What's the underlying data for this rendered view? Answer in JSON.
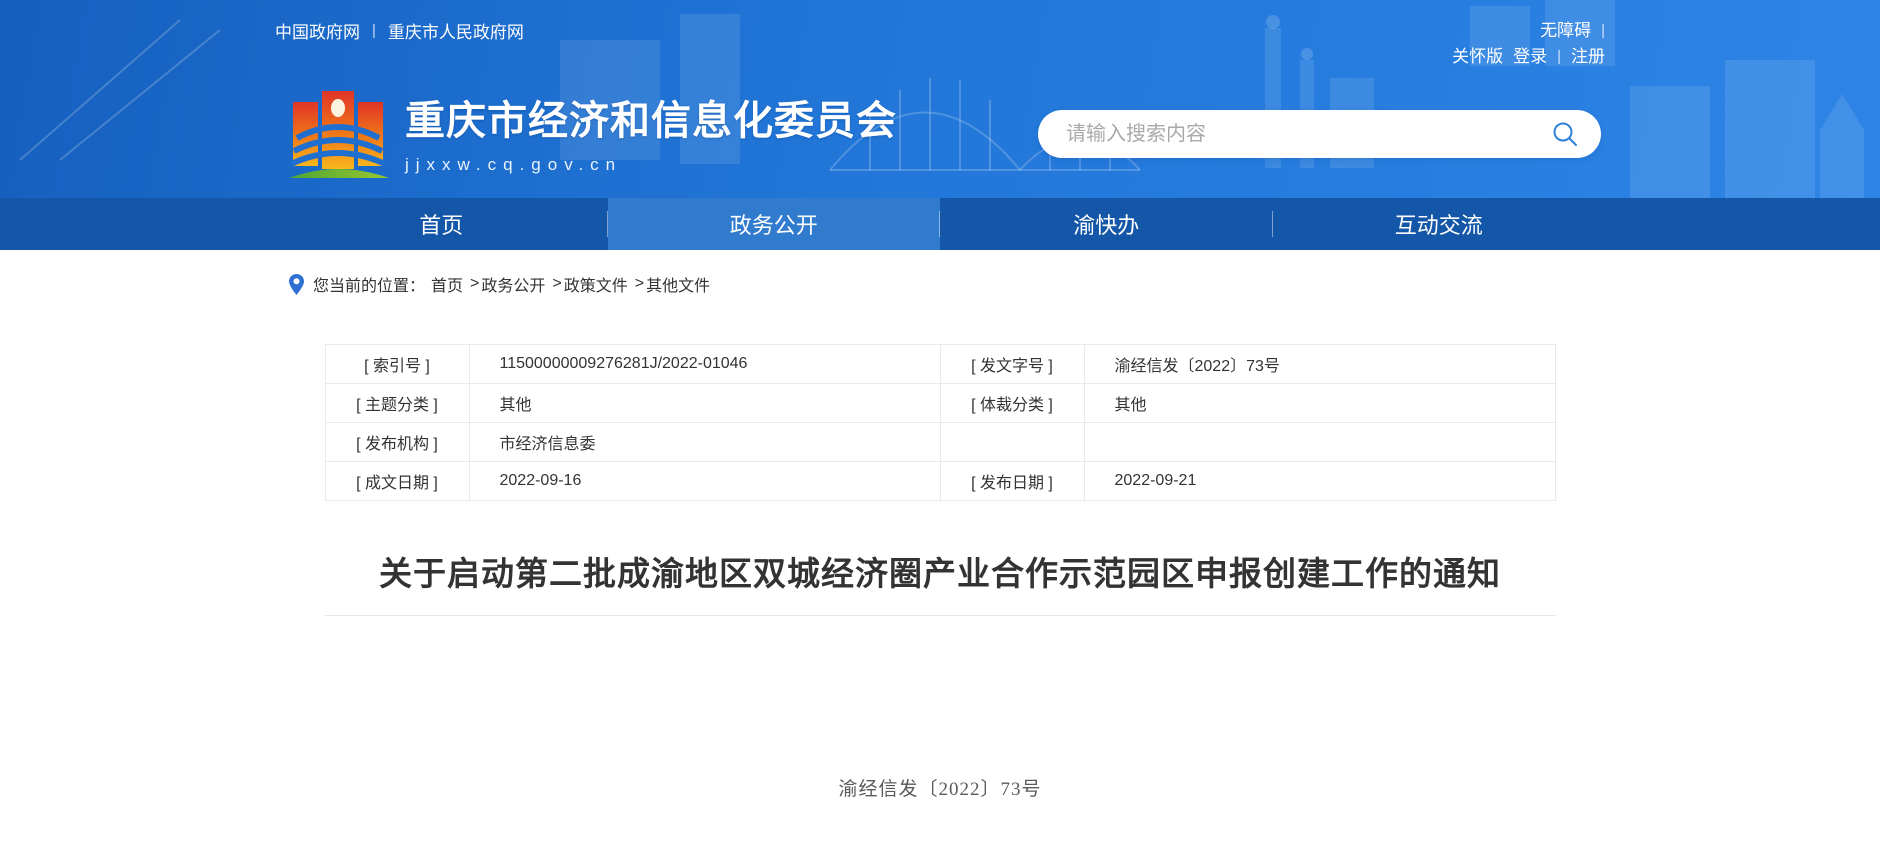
{
  "topbar": {
    "divider": "|",
    "left_links": [
      {
        "label": "中国政府网"
      },
      {
        "label": "重庆市人民政府网"
      }
    ],
    "right": {
      "accessibility": "无障碍",
      "care_version": "关怀版",
      "login": "登录",
      "register": "注册"
    }
  },
  "header": {
    "site_name": "重庆市经济和信息化委员会",
    "site_url": "jjxxw.cq.gov.cn",
    "search": {
      "placeholder": "请输入搜索内容"
    }
  },
  "nav": {
    "items": [
      {
        "label": "首页",
        "active": false
      },
      {
        "label": "政务公开",
        "active": true
      },
      {
        "label": "渝快办",
        "active": false
      },
      {
        "label": "互动交流",
        "active": false
      }
    ]
  },
  "breadcrumb": {
    "prefix": "您当前的位置：",
    "separator": ">",
    "items": [
      {
        "label": "首页"
      },
      {
        "label": "政务公开"
      },
      {
        "label": "政策文件"
      },
      {
        "label": "其他文件"
      }
    ]
  },
  "meta_table": {
    "rows": [
      {
        "l1": "[ 索引号 ]",
        "v1": "11500000009276281J/2022-01046",
        "l2": "[ 发文字号 ]",
        "v2": "渝经信发〔2022〕73号"
      },
      {
        "l1": "[ 主题分类 ]",
        "v1": "其他",
        "l2": "[ 体裁分类 ]",
        "v2": "其他"
      },
      {
        "l1": "[ 发布机构 ]",
        "v1": "市经济信息委",
        "l2": "",
        "v2": ""
      },
      {
        "l1": "[ 成文日期 ]",
        "v1": "2022-09-16",
        "l2": "[ 发布日期 ]",
        "v2": "2022-09-21"
      }
    ]
  },
  "document": {
    "title": "关于启动第二批成渝地区双城经济圈产业合作示范园区申报创建工作的通知",
    "doc_number": "渝经信发〔2022〕73号"
  },
  "colors": {
    "header_blue_start": "#1660bf",
    "header_blue_end": "#2e85e6",
    "nav_blue": "#1457a8",
    "nav_active_blue": "#307bce",
    "search_icon_blue": "#2e7fd8",
    "pin_blue": "#2e71d2",
    "table_border": "#e9e9e9",
    "text_dark": "#333333"
  }
}
